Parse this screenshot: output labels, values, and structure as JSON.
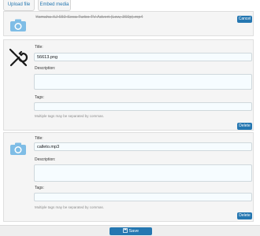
{
  "tabs": {
    "upload": "Upload file",
    "embed": "Embed media"
  },
  "upload_row": {
    "filename": "Yamaha XJ 650 Seca Turbo TV Advert (Low, 360p).mp4",
    "cancel": "Cancel"
  },
  "items": [
    {
      "title_label": "Title:",
      "title_value": "56613.png",
      "description_label": "Description:",
      "description_value": "",
      "tags_label": "Tags:",
      "tags_value": "",
      "hint": "Multiple tags may be separated by commas.",
      "delete": "Delete"
    },
    {
      "title_label": "Title:",
      "title_value": "calleto.mp3",
      "description_label": "Description:",
      "description_value": "",
      "tags_label": "Tags:",
      "tags_value": "",
      "hint": "Multiple tags may be separated by commas.",
      "delete": "Delete"
    }
  ],
  "footer": {
    "save": "Save"
  },
  "colors": {
    "accent": "#2577b1",
    "icon": "#7fbde6"
  }
}
